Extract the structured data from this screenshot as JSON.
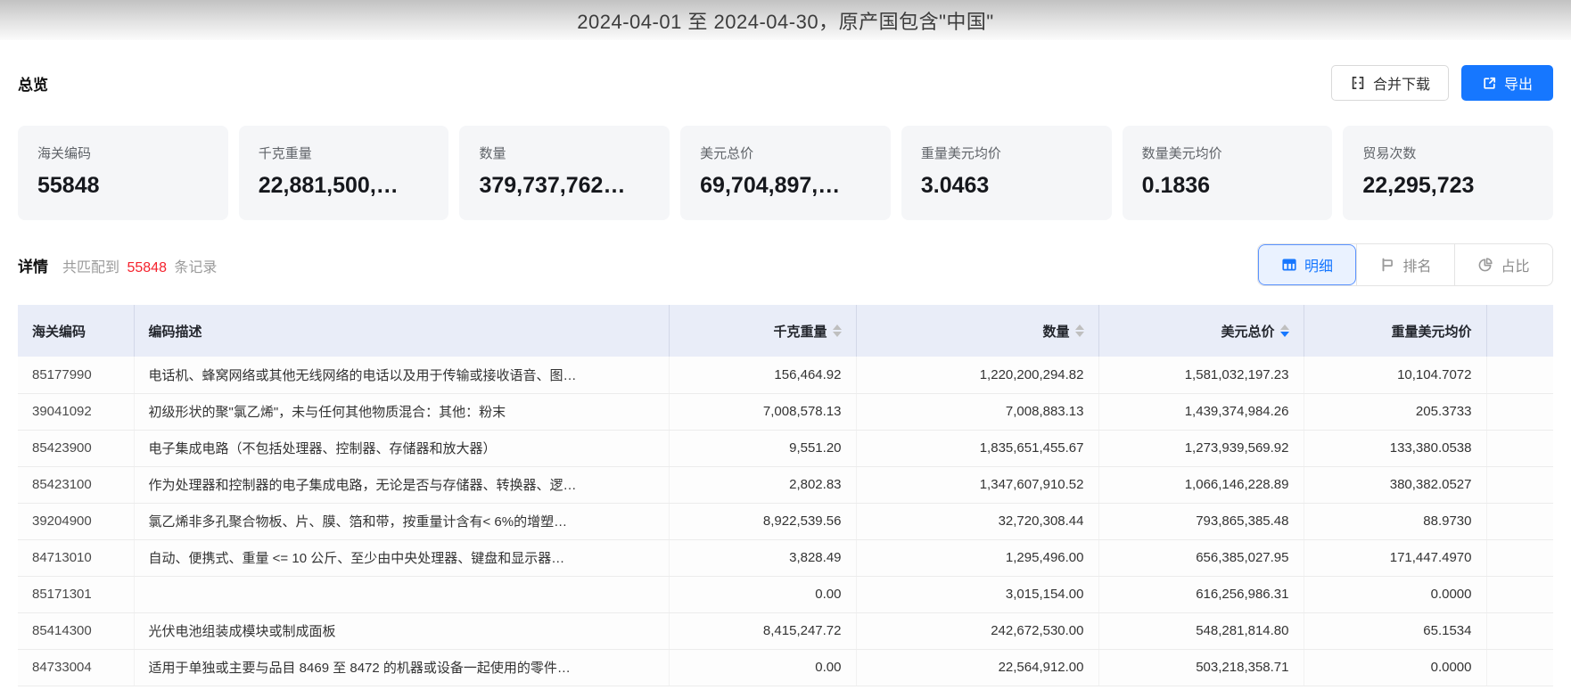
{
  "colors": {
    "accent_blue": "#1677ff",
    "count_red": "#f5222d",
    "header_bg": "#e9edf8",
    "card_bg": "#f5f6f8"
  },
  "header": {
    "title": "2024-04-01 至 2024-04-30，原产国包含\"中国\""
  },
  "overview": {
    "heading": "总览",
    "merge_button": {
      "label": "合并下载",
      "icon": "merge-cells-icon"
    },
    "export_button": {
      "label": "导出",
      "icon": "export-icon"
    },
    "cards": [
      {
        "label": "海关编码",
        "value": "55848"
      },
      {
        "label": "千克重量",
        "value": "22,881,500,…"
      },
      {
        "label": "数量",
        "value": "379,737,762…"
      },
      {
        "label": "美元总价",
        "value": "69,704,897,…"
      },
      {
        "label": "重量美元均价",
        "value": "3.0463"
      },
      {
        "label": "数量美元均价",
        "value": "0.1836"
      },
      {
        "label": "贸易次数",
        "value": "22,295,723"
      }
    ]
  },
  "detail": {
    "heading": "详情",
    "match_prefix": "共匹配到",
    "match_count": "55848",
    "match_suffix": "条记录",
    "tabs": [
      {
        "label": "明细",
        "icon": "table-icon",
        "active": true
      },
      {
        "label": "排名",
        "icon": "ranking-icon",
        "active": false
      },
      {
        "label": "占比",
        "icon": "pie-chart-icon",
        "active": false
      }
    ]
  },
  "table": {
    "columns": [
      {
        "label": "海关编码",
        "align": "left",
        "sortable": false
      },
      {
        "label": "编码描述",
        "align": "left",
        "sortable": false
      },
      {
        "label": "千克重量",
        "align": "right",
        "sortable": true
      },
      {
        "label": "数量",
        "align": "right",
        "sortable": true
      },
      {
        "label": "美元总价",
        "align": "right",
        "sortable": true,
        "sort": "desc"
      },
      {
        "label": "重量美元均价",
        "align": "right",
        "sortable": false
      }
    ],
    "rows": [
      [
        "85177990",
        "电话机、蜂窝网络或其他无线网络的电话以及用于传输或接收语音、图…",
        "156,464.92",
        "1,220,200,294.82",
        "1,581,032,197.23",
        "10,104.7072"
      ],
      [
        "39041092",
        "初级形状的聚\"氯乙烯\"，未与任何其他物质混合：其他：粉末",
        "7,008,578.13",
        "7,008,883.13",
        "1,439,374,984.26",
        "205.3733"
      ],
      [
        "85423900",
        "电子集成电路（不包括处理器、控制器、存储器和放大器）",
        "9,551.20",
        "1,835,651,455.67",
        "1,273,939,569.92",
        "133,380.0538"
      ],
      [
        "85423100",
        "作为处理器和控制器的电子集成电路，无论是否与存储器、转换器、逻…",
        "2,802.83",
        "1,347,607,910.52",
        "1,066,146,228.89",
        "380,382.0527"
      ],
      [
        "39204900",
        "氯乙烯非多孔聚合物板、片、膜、箔和带，按重量计含有< 6%的增塑…",
        "8,922,539.56",
        "32,720,308.44",
        "793,865,385.48",
        "88.9730"
      ],
      [
        "84713010",
        "自动、便携式、重量 <= 10 公斤、至少由中央处理器、键盘和显示器…",
        "3,828.49",
        "1,295,496.00",
        "656,385,027.95",
        "171,447.4970"
      ],
      [
        "85171301",
        "",
        "0.00",
        "3,015,154.00",
        "616,256,986.31",
        "0.0000"
      ],
      [
        "85414300",
        "光伏电池组装成模块或制成面板",
        "8,415,247.72",
        "242,672,530.00",
        "548,281,814.80",
        "65.1534"
      ],
      [
        "84733004",
        "适用于单独或主要与品目 8469 至 8472 的机器或设备一起使用的零件…",
        "0.00",
        "22,564,912.00",
        "503,218,358.71",
        "0.0000"
      ]
    ]
  }
}
